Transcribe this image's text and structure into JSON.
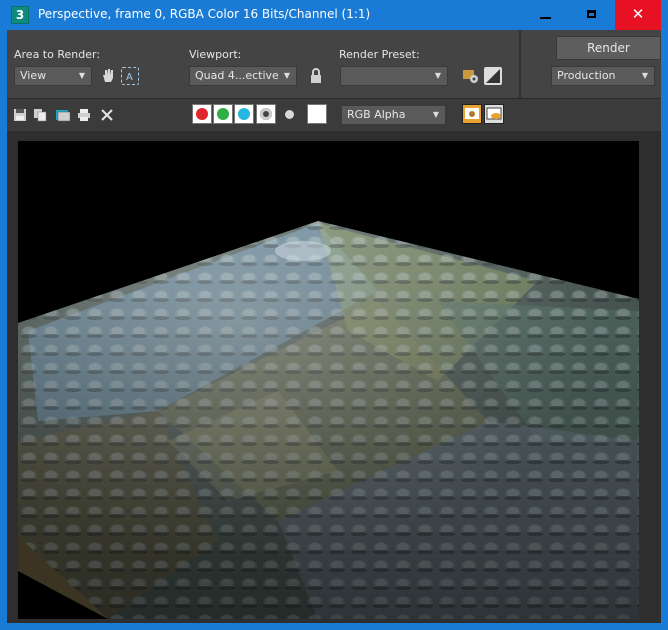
{
  "window": {
    "title": "Perspective, frame 0, RGBA Color 16 Bits/Channel (1:1)",
    "app_icon_label": "3"
  },
  "panel": {
    "area_label": "Area to Render:",
    "area_value": "View",
    "viewport_label": "Viewport:",
    "viewport_value": "Quad 4...ective",
    "preset_label": "Render Preset:",
    "preset_value": "",
    "render_button": "Render",
    "render_mode": "Production"
  },
  "toolbar": {
    "channel_display": "RGB Alpha",
    "channels": [
      {
        "name": "red",
        "color": "#e0262b"
      },
      {
        "name": "green",
        "color": "#2fae45"
      },
      {
        "name": "blue",
        "color": "#25b7e0"
      }
    ]
  },
  "colors": {
    "titlebar": "#1a7bd6",
    "panel": "#444444",
    "close": "#e81123"
  }
}
